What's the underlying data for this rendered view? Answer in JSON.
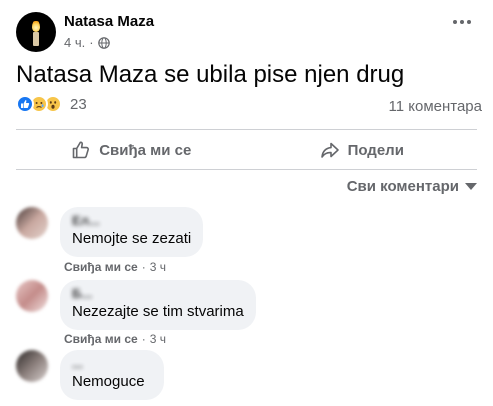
{
  "post": {
    "author": "Natasa Maza",
    "time": "4 ч.",
    "separator": "·",
    "text": "Natasa Maza se ubila pise njen drug",
    "reaction_count": "23",
    "comment_count": "11 коментара"
  },
  "actions": {
    "like_label": "Свиђа ми се",
    "share_label": "Подели"
  },
  "comments_filter": "Сви коментари",
  "comments": [
    {
      "name": "Ел...",
      "text": "Nemojte se zezati",
      "like": "Свиђа ми се",
      "separator": "·",
      "time": "3 ч"
    },
    {
      "name": "Б...",
      "text": "Nezezajte se tim stvarima",
      "like": "Свиђа ми се",
      "separator": "·",
      "time": "3 ч"
    },
    {
      "name": "...",
      "text": "Nemoguce",
      "like": "",
      "separator": "",
      "time": ""
    }
  ],
  "colors": {
    "primary_text": "#050505",
    "secondary_text": "#65676b",
    "bubble": "#f0f2f5",
    "like_blue": "#1877f2",
    "emoji_yellow": "#f7c54a"
  },
  "icons": [
    "candle-avatar",
    "globe-icon",
    "more-icon",
    "like-reaction-icon",
    "sad-reaction-icon",
    "wow-reaction-icon",
    "thumbs-up-icon",
    "share-icon",
    "chevron-down-icon"
  ]
}
